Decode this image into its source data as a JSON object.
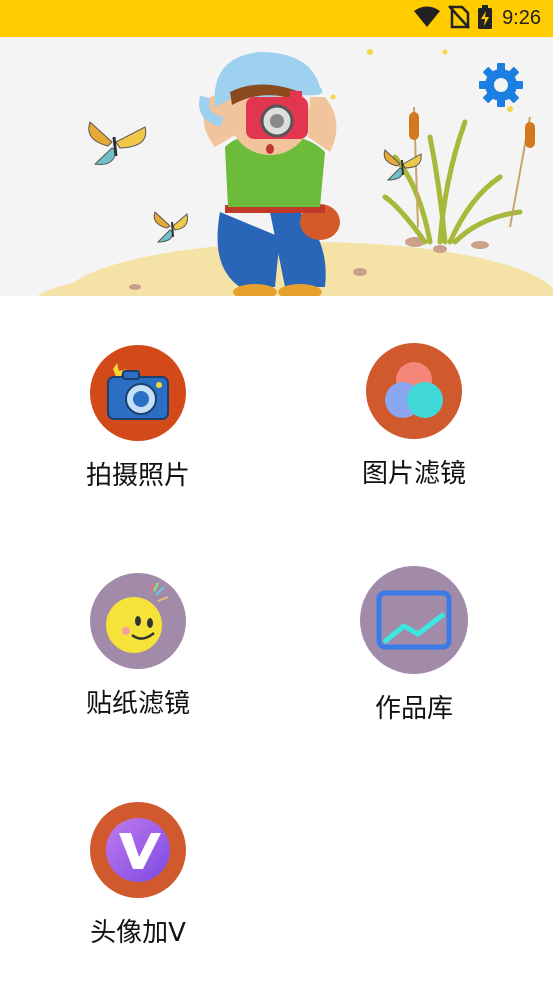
{
  "status_bar": {
    "time": "9:26",
    "icons": [
      "wifi-icon",
      "no-sim-icon",
      "battery-charging-icon"
    ],
    "background": "#FFCC00"
  },
  "banner": {
    "description_icon": "settings-gear-icon",
    "accent": "#1A7FE0"
  },
  "menu": {
    "items": [
      {
        "label": "拍摄照片",
        "icon": "camera-icon",
        "bg": "#D2491A"
      },
      {
        "label": "图片滤镜",
        "icon": "color-circles-icon",
        "bg": "#D0592E"
      },
      {
        "label": "贴纸滤镜",
        "icon": "smiley-sticker-icon",
        "bg": "#A28BA9"
      },
      {
        "label": "作品库",
        "icon": "gallery-image-icon",
        "bg": "#A28BA9"
      },
      {
        "label": "头像加V",
        "icon": "v-badge-icon",
        "bg": "#D0592E"
      }
    ]
  }
}
